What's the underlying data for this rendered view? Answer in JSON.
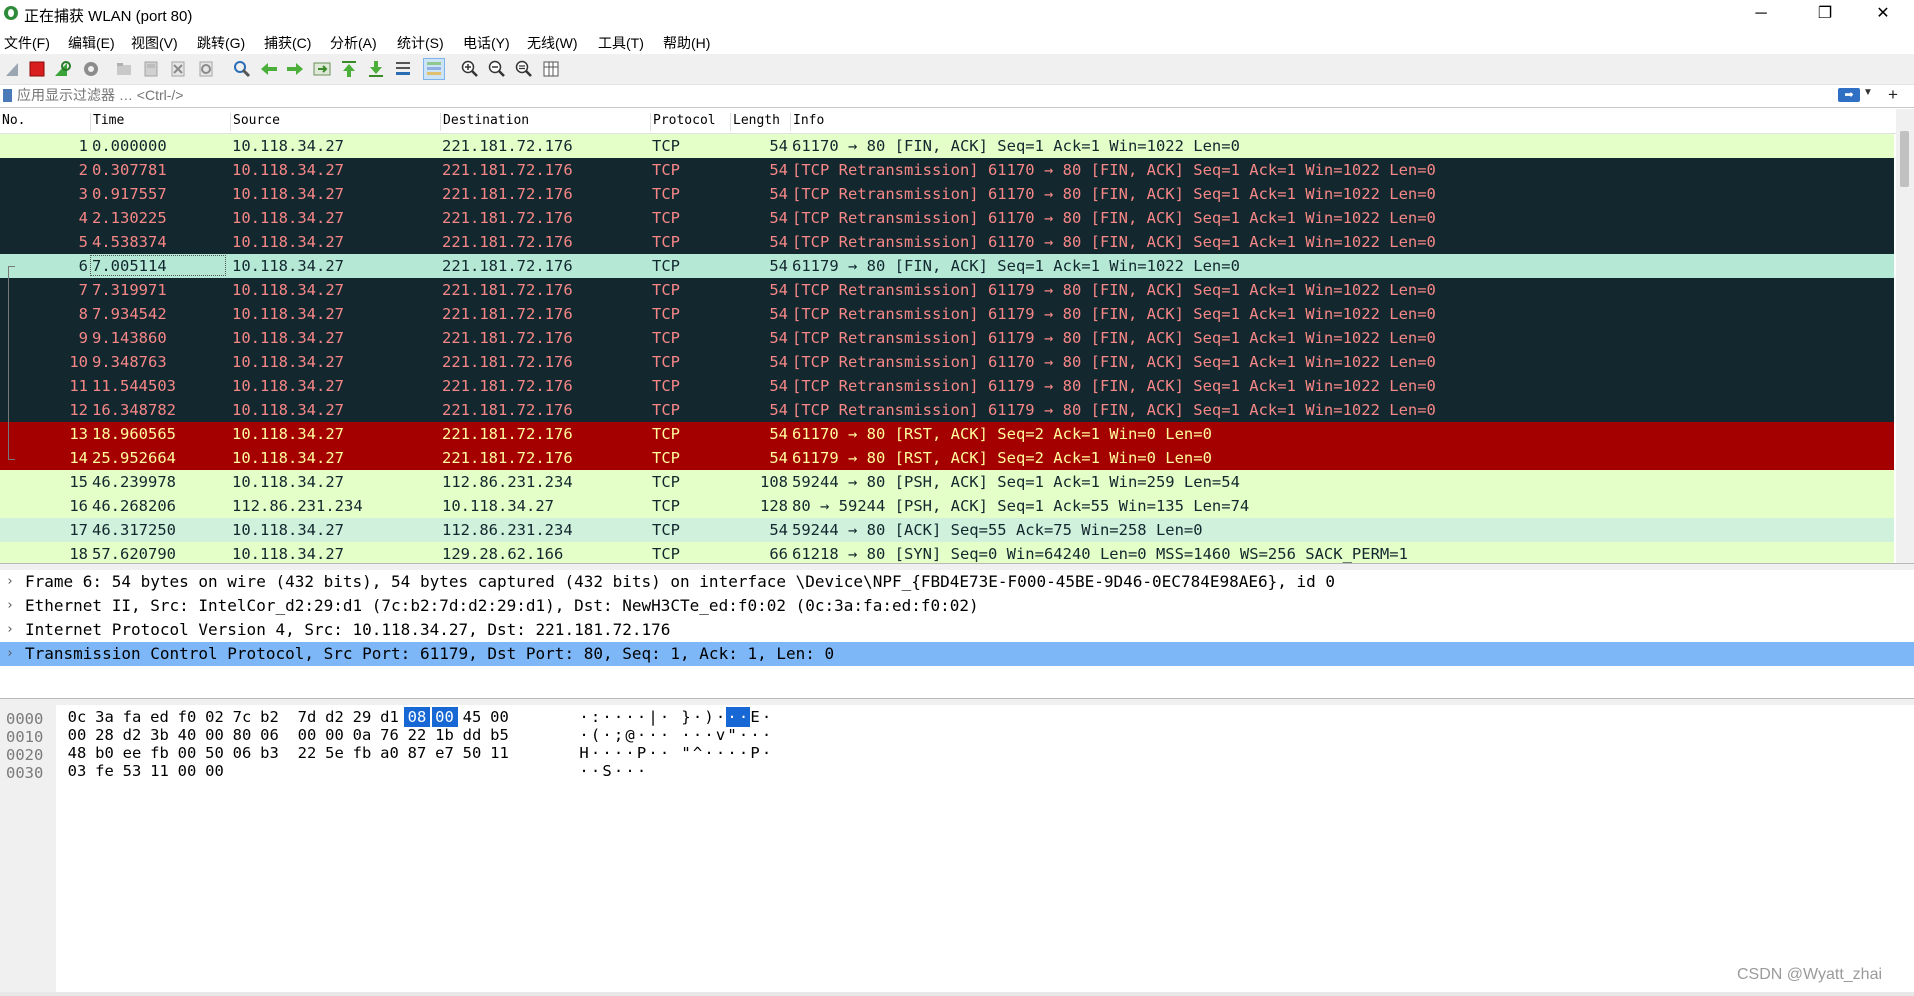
{
  "window": {
    "title": "正在捕获 WLAN (port 80)",
    "minimize": "─",
    "restore": "❐",
    "close": "✕"
  },
  "menu": [
    "文件(F)",
    "编辑(E)",
    "视图(V)",
    "跳转(G)",
    "捕获(C)",
    "分析(A)",
    "统计(S)",
    "电话(Y)",
    "无线(W)",
    "工具(T)",
    "帮助(H)"
  ],
  "toolbar_icons": [
    "shark-fin-start-icon",
    "stop-capture-icon",
    "restart-capture-icon",
    "capture-options-icon",
    "open-file-icon",
    "save-file-icon",
    "close-file-icon",
    "reload-file-icon",
    "find-packet-icon",
    "go-back-icon",
    "go-forward-icon",
    "go-to-packet-icon",
    "go-first-icon",
    "go-last-icon",
    "autoscroll-icon",
    "colorize-icon",
    "zoom-in-icon",
    "zoom-out-icon",
    "normal-size-icon",
    "resize-columns-icon"
  ],
  "filter": {
    "placeholder": "应用显示过滤器 … <Ctrl-/>",
    "value": ""
  },
  "columns": {
    "no": "No.",
    "time": "Time",
    "source": "Source",
    "destination": "Destination",
    "protocol": "Protocol",
    "length": "Length",
    "info": "Info"
  },
  "packets": [
    {
      "no": "1",
      "time": "0.000000",
      "src": "10.118.34.27",
      "dst": "221.181.72.176",
      "proto": "TCP",
      "len": "54",
      "info": "61170 → 80 [FIN, ACK] Seq=1 Ack=1 Win=1022 Len=0",
      "bg": "#e4ffc7",
      "fg": "#12272e"
    },
    {
      "no": "2",
      "time": "0.307781",
      "src": "10.118.34.27",
      "dst": "221.181.72.176",
      "proto": "TCP",
      "len": "54",
      "info": "[TCP Retransmission] 61170 → 80 [FIN, ACK] Seq=1 Ack=1 Win=1022 Len=0",
      "bg": "#12272e",
      "fg": "#f78787"
    },
    {
      "no": "3",
      "time": "0.917557",
      "src": "10.118.34.27",
      "dst": "221.181.72.176",
      "proto": "TCP",
      "len": "54",
      "info": "[TCP Retransmission] 61170 → 80 [FIN, ACK] Seq=1 Ack=1 Win=1022 Len=0",
      "bg": "#12272e",
      "fg": "#f78787"
    },
    {
      "no": "4",
      "time": "2.130225",
      "src": "10.118.34.27",
      "dst": "221.181.72.176",
      "proto": "TCP",
      "len": "54",
      "info": "[TCP Retransmission] 61170 → 80 [FIN, ACK] Seq=1 Ack=1 Win=1022 Len=0",
      "bg": "#12272e",
      "fg": "#f78787"
    },
    {
      "no": "5",
      "time": "4.538374",
      "src": "10.118.34.27",
      "dst": "221.181.72.176",
      "proto": "TCP",
      "len": "54",
      "info": "[TCP Retransmission] 61170 → 80 [FIN, ACK] Seq=1 Ack=1 Win=1022 Len=0",
      "bg": "#12272e",
      "fg": "#f78787"
    },
    {
      "no": "6",
      "time": "7.005114",
      "src": "10.118.34.27",
      "dst": "221.181.72.176",
      "proto": "TCP",
      "len": "54",
      "info": "61179 → 80 [FIN, ACK] Seq=1 Ack=1 Win=1022 Len=0",
      "bg": "#b5e9d6",
      "fg": "#12272e",
      "selected": true
    },
    {
      "no": "7",
      "time": "7.319971",
      "src": "10.118.34.27",
      "dst": "221.181.72.176",
      "proto": "TCP",
      "len": "54",
      "info": "[TCP Retransmission] 61179 → 80 [FIN, ACK] Seq=1 Ack=1 Win=1022 Len=0",
      "bg": "#12272e",
      "fg": "#f78787"
    },
    {
      "no": "8",
      "time": "7.934542",
      "src": "10.118.34.27",
      "dst": "221.181.72.176",
      "proto": "TCP",
      "len": "54",
      "info": "[TCP Retransmission] 61179 → 80 [FIN, ACK] Seq=1 Ack=1 Win=1022 Len=0",
      "bg": "#12272e",
      "fg": "#f78787"
    },
    {
      "no": "9",
      "time": "9.143860",
      "src": "10.118.34.27",
      "dst": "221.181.72.176",
      "proto": "TCP",
      "len": "54",
      "info": "[TCP Retransmission] 61179 → 80 [FIN, ACK] Seq=1 Ack=1 Win=1022 Len=0",
      "bg": "#12272e",
      "fg": "#f78787"
    },
    {
      "no": "10",
      "time": "9.348763",
      "src": "10.118.34.27",
      "dst": "221.181.72.176",
      "proto": "TCP",
      "len": "54",
      "info": "[TCP Retransmission] 61170 → 80 [FIN, ACK] Seq=1 Ack=1 Win=1022 Len=0",
      "bg": "#12272e",
      "fg": "#f78787"
    },
    {
      "no": "11",
      "time": "11.544503",
      "src": "10.118.34.27",
      "dst": "221.181.72.176",
      "proto": "TCP",
      "len": "54",
      "info": "[TCP Retransmission] 61179 → 80 [FIN, ACK] Seq=1 Ack=1 Win=1022 Len=0",
      "bg": "#12272e",
      "fg": "#f78787"
    },
    {
      "no": "12",
      "time": "16.348782",
      "src": "10.118.34.27",
      "dst": "221.181.72.176",
      "proto": "TCP",
      "len": "54",
      "info": "[TCP Retransmission] 61179 → 80 [FIN, ACK] Seq=1 Ack=1 Win=1022 Len=0",
      "bg": "#12272e",
      "fg": "#f78787"
    },
    {
      "no": "13",
      "time": "18.960565",
      "src": "10.118.34.27",
      "dst": "221.181.72.176",
      "proto": "TCP",
      "len": "54",
      "info": "61170 → 80 [RST, ACK] Seq=2 Ack=1 Win=0 Len=0",
      "bg": "#a40000",
      "fg": "#fffc9c"
    },
    {
      "no": "14",
      "time": "25.952664",
      "src": "10.118.34.27",
      "dst": "221.181.72.176",
      "proto": "TCP",
      "len": "54",
      "info": "61179 → 80 [RST, ACK] Seq=2 Ack=1 Win=0 Len=0",
      "bg": "#a40000",
      "fg": "#fffc9c"
    },
    {
      "no": "15",
      "time": "46.239978",
      "src": "10.118.34.27",
      "dst": "112.86.231.234",
      "proto": "TCP",
      "len": "108",
      "info": "59244 → 80 [PSH, ACK] Seq=1 Ack=1 Win=259 Len=54",
      "bg": "#e4ffc7",
      "fg": "#12272e"
    },
    {
      "no": "16",
      "time": "46.268206",
      "src": "112.86.231.234",
      "dst": "10.118.34.27",
      "proto": "TCP",
      "len": "128",
      "info": "80 → 59244 [PSH, ACK] Seq=1 Ack=55 Win=135 Len=74",
      "bg": "#e4ffc7",
      "fg": "#12272e"
    },
    {
      "no": "17",
      "time": "46.317250",
      "src": "10.118.34.27",
      "dst": "112.86.231.234",
      "proto": "TCP",
      "len": "54",
      "info": "59244 → 80 [ACK] Seq=55 Ack=75 Win=258 Len=0",
      "bg": "#d0f1dc",
      "fg": "#12272e"
    },
    {
      "no": "18",
      "time": "57.620790",
      "src": "10.118.34.27",
      "dst": "129.28.62.166",
      "proto": "TCP",
      "len": "66",
      "info": "61218 → 80 [SYN] Seq=0 Win=64240 Len=0 MSS=1460 WS=256 SACK_PERM=1",
      "bg": "#e4ffc7",
      "fg": "#12272e"
    }
  ],
  "details": [
    {
      "text": "Frame 6: 54 bytes on wire (432 bits), 54 bytes captured (432 bits) on interface \\Device\\NPF_{FBD4E73E-F000-45BE-9D46-0EC784E98AE6}, id 0",
      "selected": false
    },
    {
      "text": "Ethernet II, Src: IntelCor_d2:29:d1 (7c:b2:7d:d2:29:d1), Dst: NewH3CTe_ed:f0:02 (0c:3a:fa:ed:f0:02)",
      "selected": false
    },
    {
      "text": "Internet Protocol Version 4, Src: 10.118.34.27, Dst: 221.181.72.176",
      "selected": false
    },
    {
      "text": "Transmission Control Protocol, Src Port: 61179, Dst Port: 80, Seq: 1, Ack: 1, Len: 0",
      "selected": true
    }
  ],
  "bytes": [
    {
      "offset": "0000",
      "hex": [
        "0c",
        "3a",
        "fa",
        "ed",
        "f0",
        "02",
        "7c",
        "b2",
        "7d",
        "d2",
        "29",
        "d1",
        "08",
        "00",
        "45",
        "00"
      ],
      "ascii": [
        "·",
        ":",
        "·",
        "·",
        "·",
        "·",
        "|",
        "·",
        "}",
        "·",
        ")",
        "·",
        "·",
        "·",
        "E",
        "·"
      ],
      "highlight": [
        12,
        13
      ]
    },
    {
      "offset": "0010",
      "hex": [
        "00",
        "28",
        "d2",
        "3b",
        "40",
        "00",
        "80",
        "06",
        "00",
        "00",
        "0a",
        "76",
        "22",
        "1b",
        "dd",
        "b5"
      ],
      "ascii": [
        "·",
        "(",
        "·",
        ";",
        "@",
        "·",
        "·",
        "·",
        "·",
        "·",
        "·",
        "v",
        "\"",
        "·",
        "·",
        "·"
      ],
      "highlight": []
    },
    {
      "offset": "0020",
      "hex": [
        "48",
        "b0",
        "ee",
        "fb",
        "00",
        "50",
        "06",
        "b3",
        "22",
        "5e",
        "fb",
        "a0",
        "87",
        "e7",
        "50",
        "11"
      ],
      "ascii": [
        "H",
        "·",
        "·",
        "·",
        "·",
        "P",
        "·",
        "·",
        "\"",
        "^",
        "·",
        "·",
        "·",
        "·",
        "P",
        "·"
      ],
      "highlight": []
    },
    {
      "offset": "0030",
      "hex": [
        "03",
        "fe",
        "53",
        "11",
        "00",
        "00"
      ],
      "ascii": [
        "·",
        "·",
        "S",
        "·",
        "·",
        "·"
      ],
      "highlight": []
    }
  ],
  "watermark": "CSDN @Wyatt_zhai",
  "colors": {
    "selected_detail_bg": "#7db7f7",
    "byte_highlight": "#1767d4"
  }
}
